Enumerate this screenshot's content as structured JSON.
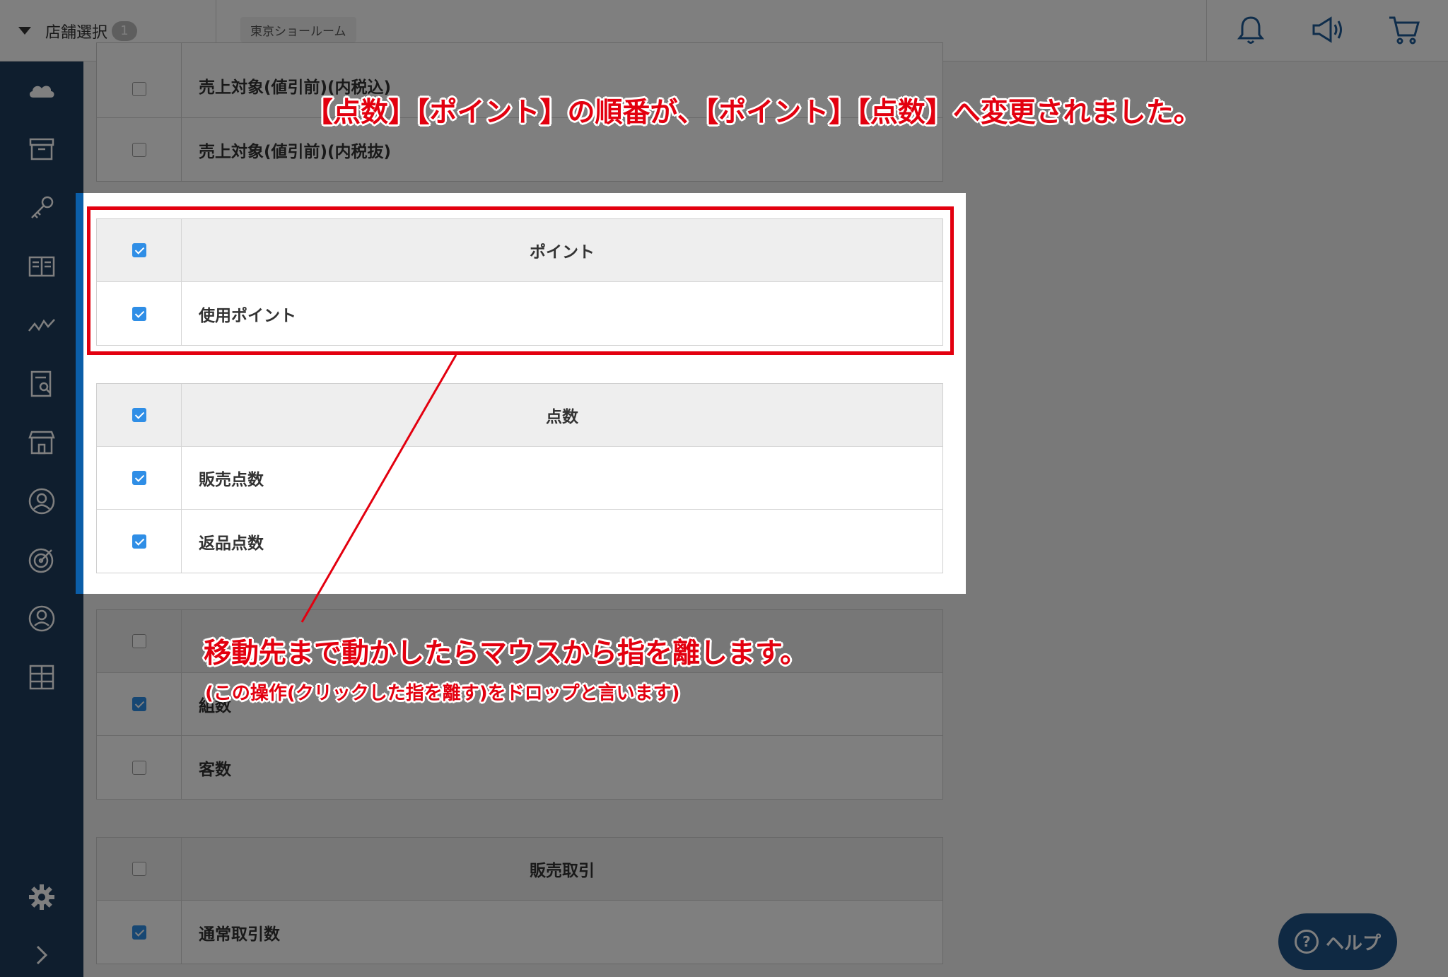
{
  "header": {
    "store_select_label": "店舗選択",
    "store_count": "1",
    "store_chip": "東京ショールーム",
    "icons": [
      "bell-icon",
      "megaphone-icon",
      "cart-icon"
    ]
  },
  "sidebar": {
    "icons": [
      "cloud-icon",
      "box-icon",
      "key-icon",
      "book-icon",
      "chart-icon",
      "report-icon",
      "store-icon",
      "user-circle-icon",
      "target-icon",
      "profile-icon",
      "grid-icon",
      "gear-icon",
      "chevron-right-icon"
    ]
  },
  "background_table_top": {
    "rows": [
      {
        "label": "売上対象(値引前)(内税込)",
        "checked": false
      },
      {
        "label": "売上対象(値引前)(内税抜)",
        "checked": false
      }
    ]
  },
  "points_table": {
    "header": "ポイント",
    "header_checked": true,
    "rows": [
      {
        "label": "使用ポイント",
        "checked": true
      }
    ]
  },
  "quantity_table": {
    "header": "点数",
    "header_checked": true,
    "rows": [
      {
        "label": "販売点数",
        "checked": true
      },
      {
        "label": "返品点数",
        "checked": true
      }
    ]
  },
  "background_table_mid": {
    "rows": [
      {
        "label": "",
        "checked": false
      },
      {
        "label": "組数",
        "checked": true
      },
      {
        "label": "客数",
        "checked": false
      }
    ]
  },
  "sales_table": {
    "header": "販売取引",
    "header_checked": false,
    "rows": [
      {
        "label": "通常取引数",
        "checked": true
      }
    ]
  },
  "annotations": {
    "top": "【点数】【ポイント】の順番が、【ポイント】【点数】へ変更されました。",
    "main": "移動先まで動かしたらマウスから指を離します。",
    "sub": "(この操作(クリックした指を離す)をドロップと言います)"
  },
  "help": {
    "label": "ヘルプ"
  },
  "colors": {
    "sidebar": "#1f3d5c",
    "accent": "#0b5ea8",
    "checkbox": "#2f8ee6",
    "annotation": "#e3000f"
  }
}
